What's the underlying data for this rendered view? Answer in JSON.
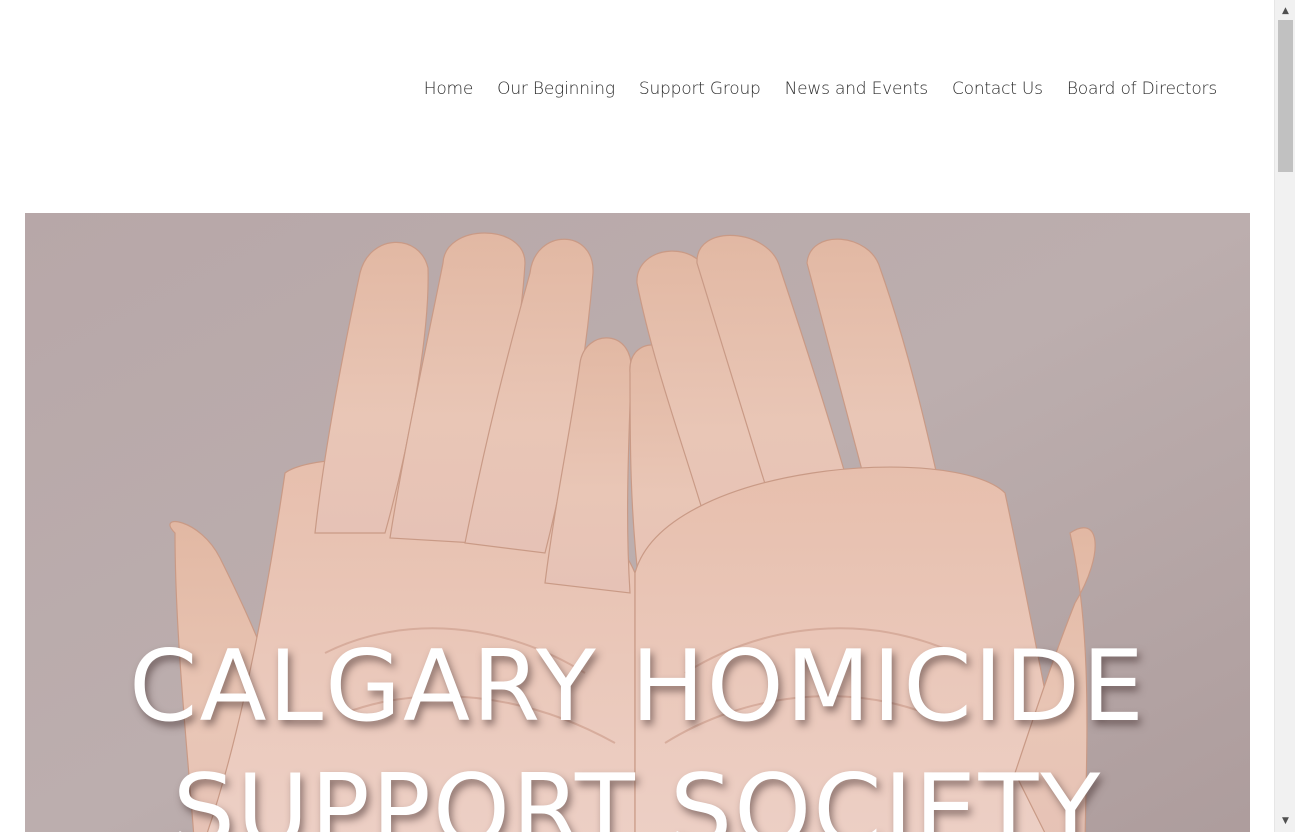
{
  "nav": {
    "items": [
      {
        "label": "Home"
      },
      {
        "label": "Our Beginning"
      },
      {
        "label": "Support Group"
      },
      {
        "label": "News and Events"
      },
      {
        "label": "Contact Us"
      },
      {
        "label": "Board of Directors"
      }
    ]
  },
  "hero": {
    "title": "CALGARY HOMICIDE\nSUPPORT SOCIETY",
    "image": "open-cupped-hands-photo",
    "text_color": "#ffffff",
    "background_color": "#b9a8a7"
  },
  "scrollbar": {
    "up_icon": "scroll-up-arrow-icon",
    "down_icon": "scroll-down-arrow-icon"
  }
}
